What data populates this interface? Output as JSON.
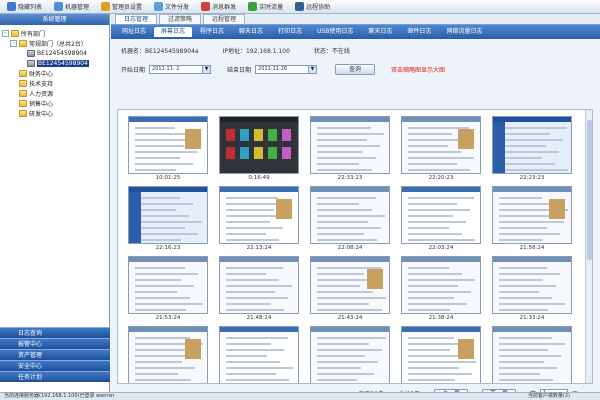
{
  "toolbar": [
    {
      "label": "隐藏列表",
      "icon": "list-icon",
      "color": "#3a7bd5"
    },
    {
      "label": "机器管理",
      "icon": "computer-icon",
      "color": "#4a90d9"
    },
    {
      "label": "管理员设置",
      "icon": "admin-icon",
      "color": "#e0a020"
    },
    {
      "label": "文件分发",
      "icon": "file-icon",
      "color": "#5aa0e0"
    },
    {
      "label": "消息群发",
      "icon": "message-icon",
      "color": "#d04040"
    },
    {
      "label": "实时流量",
      "icon": "traffic-icon",
      "color": "#40a040"
    },
    {
      "label": "远程协助",
      "icon": "remote-icon",
      "color": "#306090"
    }
  ],
  "left": {
    "title": "系统管理",
    "tree": [
      {
        "label": "所有部门",
        "type": "folder",
        "indent": 0,
        "expander": "-",
        "selected": false
      },
      {
        "label": "常规部门（总共2台）",
        "type": "folder",
        "indent": 1,
        "expander": "-",
        "selected": false
      },
      {
        "label": "BE12454598904",
        "type": "pc",
        "indent": 2,
        "expander": "",
        "selected": false
      },
      {
        "label": "BE12454598904",
        "type": "pc",
        "indent": 2,
        "expander": "",
        "selected": true
      },
      {
        "label": "财务中心",
        "type": "folder",
        "indent": 1,
        "expander": "",
        "selected": false
      },
      {
        "label": "技术支持",
        "type": "folder",
        "indent": 1,
        "expander": "",
        "selected": false
      },
      {
        "label": "人力资源",
        "type": "folder",
        "indent": 1,
        "expander": "",
        "selected": false
      },
      {
        "label": "销售中心",
        "type": "folder",
        "indent": 1,
        "expander": "",
        "selected": false
      },
      {
        "label": "研发中心",
        "type": "folder",
        "indent": 1,
        "expander": "",
        "selected": false
      }
    ],
    "accordion": [
      "日志查询",
      "报警中心",
      "资产管理",
      "安全中心",
      "任务计划"
    ]
  },
  "tabs1": [
    {
      "label": "日志管理",
      "active": true
    },
    {
      "label": "过滤策略",
      "active": false
    },
    {
      "label": "远程管理",
      "active": false
    }
  ],
  "tabs2": [
    {
      "label": "网址日志",
      "active": false
    },
    {
      "label": "屏幕日志",
      "active": true
    },
    {
      "label": "程序日志",
      "active": false
    },
    {
      "label": "聊天日志",
      "active": false
    },
    {
      "label": "打印日志",
      "active": false
    },
    {
      "label": "USB使用日志",
      "active": false
    },
    {
      "label": "聊天日志",
      "active": false
    },
    {
      "label": "邮件日志",
      "active": false
    },
    {
      "label": "网络流量日志",
      "active": false
    }
  ],
  "info": {
    "machine_label": "机器名：",
    "machine_value": "BE12454598904a",
    "ip_label": "IP地址：",
    "ip_value": "192.168.1.100",
    "status_label": "状态：",
    "status_value": "不在线"
  },
  "filter": {
    "start_label": "开始日期",
    "start_value": "2011-11- 2",
    "end_label": "结束日期",
    "end_value": "2011-11-26",
    "query_label": "查询",
    "hint": "双击缩略图显示大图"
  },
  "thumbs": [
    {
      "time": "10:01:25",
      "theme": "web"
    },
    {
      "time": "0:16:49",
      "theme": "game"
    },
    {
      "time": "22:33:23",
      "theme": "doc"
    },
    {
      "time": "22:20:23",
      "theme": "doc"
    },
    {
      "time": "22:23:23",
      "theme": "blue"
    },
    {
      "time": "22:16:23",
      "theme": "blue"
    },
    {
      "time": "22:13:24",
      "theme": "web"
    },
    {
      "time": "22:08:24",
      "theme": "doc"
    },
    {
      "time": "22:03:24",
      "theme": "web"
    },
    {
      "time": "21:58:24",
      "theme": "doc"
    },
    {
      "time": "21:53:24",
      "theme": "doc"
    },
    {
      "time": "21:48:24",
      "theme": "doc"
    },
    {
      "time": "21:43:24",
      "theme": "doc"
    },
    {
      "time": "21:38:24",
      "theme": "doc"
    },
    {
      "time": "21:33:24",
      "theme": "doc"
    },
    {
      "time": "",
      "theme": "doc"
    },
    {
      "time": "",
      "theme": "web"
    },
    {
      "time": "",
      "theme": "doc"
    },
    {
      "time": "",
      "theme": "web"
    },
    {
      "time": "",
      "theme": "doc"
    }
  ],
  "pager": {
    "per_page": "每页30条",
    "total": "总共8页",
    "prev": "上一页",
    "next": "下一页",
    "page_label": "第",
    "page_value": "1",
    "page_unit": "页"
  },
  "status": {
    "left": "当前连接服务器(192.168.1.100)已登录 wanrsn",
    "right": "当前客户端数量(2)"
  }
}
